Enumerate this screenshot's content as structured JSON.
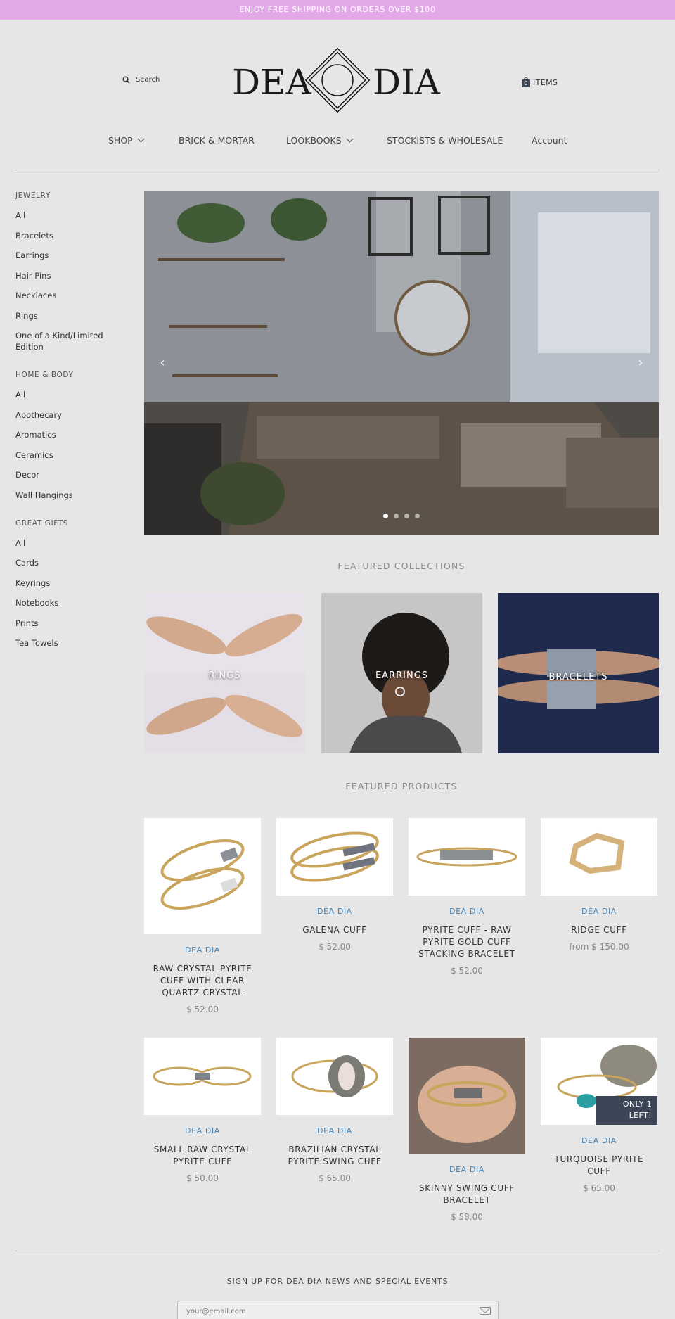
{
  "announcement": "ENJOY FREE SHIPPING ON ORDERS OVER $100",
  "header": {
    "search_label": "Search",
    "logo_left": "DEA",
    "logo_right": "DIA",
    "cart_count": "0",
    "cart_label": "ITEMS"
  },
  "nav": {
    "items": [
      {
        "label": "SHOP",
        "dropdown": true
      },
      {
        "label": "BRICK & MORTAR",
        "dropdown": false
      },
      {
        "label": "LOOKBOOKS",
        "dropdown": true
      },
      {
        "label": "STOCKISTS & WHOLESALE",
        "dropdown": false
      },
      {
        "label": "Account",
        "dropdown": false
      }
    ]
  },
  "sidebar": {
    "groups": [
      {
        "title": "JEWELRY",
        "links": [
          "All",
          "Bracelets",
          "Earrings",
          "Hair Pins",
          "Necklaces",
          "Rings",
          "One of a Kind/Limited Edition"
        ]
      },
      {
        "title": "HOME & BODY",
        "links": [
          "All",
          "Apothecary",
          "Aromatics",
          "Ceramics",
          "Decor",
          "Wall Hangings"
        ]
      },
      {
        "title": "GREAT GIFTS",
        "links": [
          "All",
          "Cards",
          "Keyrings",
          "Notebooks",
          "Prints",
          "Tea Towels"
        ]
      }
    ]
  },
  "slideshow": {
    "prev_icon": "chevron-left-icon",
    "next_icon": "chevron-right-icon",
    "dot_count": 4,
    "active_dot": 1
  },
  "featured_collections": {
    "title": "FEATURED COLLECTIONS",
    "items": [
      "RINGS",
      "EARRINGS",
      "BRACELETS"
    ]
  },
  "featured_products": {
    "title": "FEATURED PRODUCTS",
    "items": [
      {
        "vendor": "DEA DIA",
        "name": "RAW CRYSTAL PYRITE CUFF WITH CLEAR QUARTZ CRYSTAL",
        "price": "$ 52.00"
      },
      {
        "vendor": "DEA DIA",
        "name": "GALENA CUFF",
        "price": "$ 52.00"
      },
      {
        "vendor": "DEA DIA",
        "name": "PYRITE CUFF - RAW PYRITE GOLD CUFF STACKING BRACELET",
        "price": "$ 52.00"
      },
      {
        "vendor": "DEA DIA",
        "name": "RIDGE CUFF",
        "price": "from $ 150.00"
      },
      {
        "vendor": "DEA DIA",
        "name": "SMALL RAW CRYSTAL PYRITE CUFF",
        "price": "$ 50.00"
      },
      {
        "vendor": "DEA DIA",
        "name": "BRAZILIAN CRYSTAL PYRITE SWING CUFF",
        "price": "$ 65.00"
      },
      {
        "vendor": "DEA DIA",
        "name": "SKINNY SWING CUFF BRACELET",
        "price": "$ 58.00"
      },
      {
        "vendor": "DEA DIA",
        "name": "TURQUOISE PYRITE CUFF",
        "price": "$ 65.00",
        "badge": "ONLY 1 LEFT!"
      }
    ]
  },
  "newsletter": {
    "title": "SIGN UP FOR DEA DIA NEWS AND SPECIAL EVENTS",
    "placeholder": "your@email.com"
  },
  "colors": {
    "announcement_bg": "#e3a8e8",
    "page_bg": "#e6e6e6",
    "vendor_text": "#4a86b4",
    "badge_bg": "#3c4656"
  }
}
